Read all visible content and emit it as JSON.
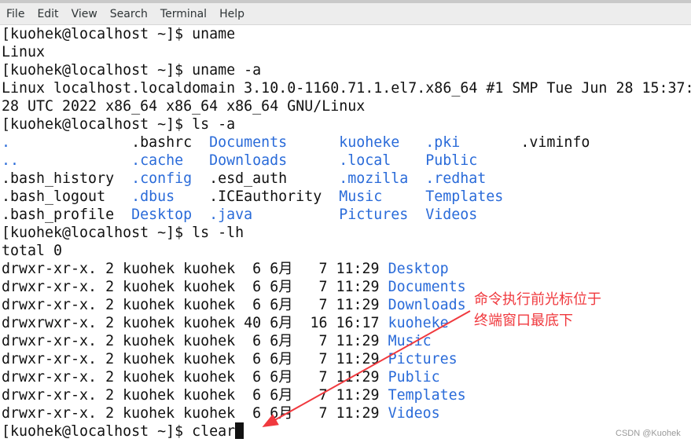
{
  "menu": [
    "File",
    "Edit",
    "View",
    "Search",
    "Terminal",
    "Help"
  ],
  "colors": {
    "directory": "#2a6bd9",
    "annotation": "#f0393e"
  },
  "terminal": {
    "lines_before": [
      "[kuohek@localhost ~]$ uname",
      "Linux",
      "[kuohek@localhost ~]$ uname -a",
      "Linux localhost.localdomain 3.10.0-1160.71.1.el7.x86_64 #1 SMP Tue Jun 28 15:37:",
      "28 UTC 2022 x86_64 x86_64 x86_64 GNU/Linux",
      "[kuohek@localhost ~]$ ls -a"
    ],
    "ls_a_rows": [
      [
        {
          "t": ".",
          "d": true
        },
        {
          "t": ".bashrc",
          "d": false
        },
        {
          "t": "Documents",
          "d": true
        },
        {
          "t": "kuoheke",
          "d": true
        },
        {
          "t": ".pki",
          "d": true
        },
        {
          "t": ".viminfo",
          "d": false
        }
      ],
      [
        {
          "t": "..",
          "d": true
        },
        {
          "t": ".cache",
          "d": true
        },
        {
          "t": "Downloads",
          "d": true
        },
        {
          "t": ".local",
          "d": true
        },
        {
          "t": "Public",
          "d": true
        }
      ],
      [
        {
          "t": ".bash_history",
          "d": false
        },
        {
          "t": ".config",
          "d": true
        },
        {
          "t": ".esd_auth",
          "d": false
        },
        {
          "t": ".mozilla",
          "d": true
        },
        {
          "t": ".redhat",
          "d": true
        }
      ],
      [
        {
          "t": ".bash_logout",
          "d": false
        },
        {
          "t": ".dbus",
          "d": true
        },
        {
          "t": ".ICEauthority",
          "d": false
        },
        {
          "t": "Music",
          "d": true
        },
        {
          "t": "Templates",
          "d": true
        }
      ],
      [
        {
          "t": ".bash_profile",
          "d": false
        },
        {
          "t": "Desktop",
          "d": true
        },
        {
          "t": ".java",
          "d": true
        },
        {
          "t": "Pictures",
          "d": true
        },
        {
          "t": "Videos",
          "d": true
        }
      ]
    ],
    "ls_lh_command": "[kuohek@localhost ~]$ ls -lh",
    "total": "total 0",
    "ls_lh_rows": [
      {
        "prefix": "drwxr-xr-x. 2 kuohek kuohek  6 6月   7 11:29 ",
        "name": "Desktop"
      },
      {
        "prefix": "drwxr-xr-x. 2 kuohek kuohek  6 6月   7 11:29 ",
        "name": "Documents"
      },
      {
        "prefix": "drwxr-xr-x. 2 kuohek kuohek  6 6月   7 11:29 ",
        "name": "Downloads"
      },
      {
        "prefix": "drwxrwxr-x. 2 kuohek kuohek 40 6月  16 16:17 ",
        "name": "kuoheke"
      },
      {
        "prefix": "drwxr-xr-x. 2 kuohek kuohek  6 6月   7 11:29 ",
        "name": "Music"
      },
      {
        "prefix": "drwxr-xr-x. 2 kuohek kuohek  6 6月   7 11:29 ",
        "name": "Pictures"
      },
      {
        "prefix": "drwxr-xr-x. 2 kuohek kuohek  6 6月   7 11:29 ",
        "name": "Public"
      },
      {
        "prefix": "drwxr-xr-x. 2 kuohek kuohek  6 6月   7 11:29 ",
        "name": "Templates"
      },
      {
        "prefix": "drwxr-xr-x. 2 kuohek kuohek  6 6月   7 11:29 ",
        "name": "Videos"
      }
    ],
    "current_input": "[kuohek@localhost ~]$ clear"
  },
  "annotation": {
    "line1": "命令执行前光标位于",
    "line2": "终端窗口最底下"
  },
  "watermark": "CSDN @Kuohek"
}
